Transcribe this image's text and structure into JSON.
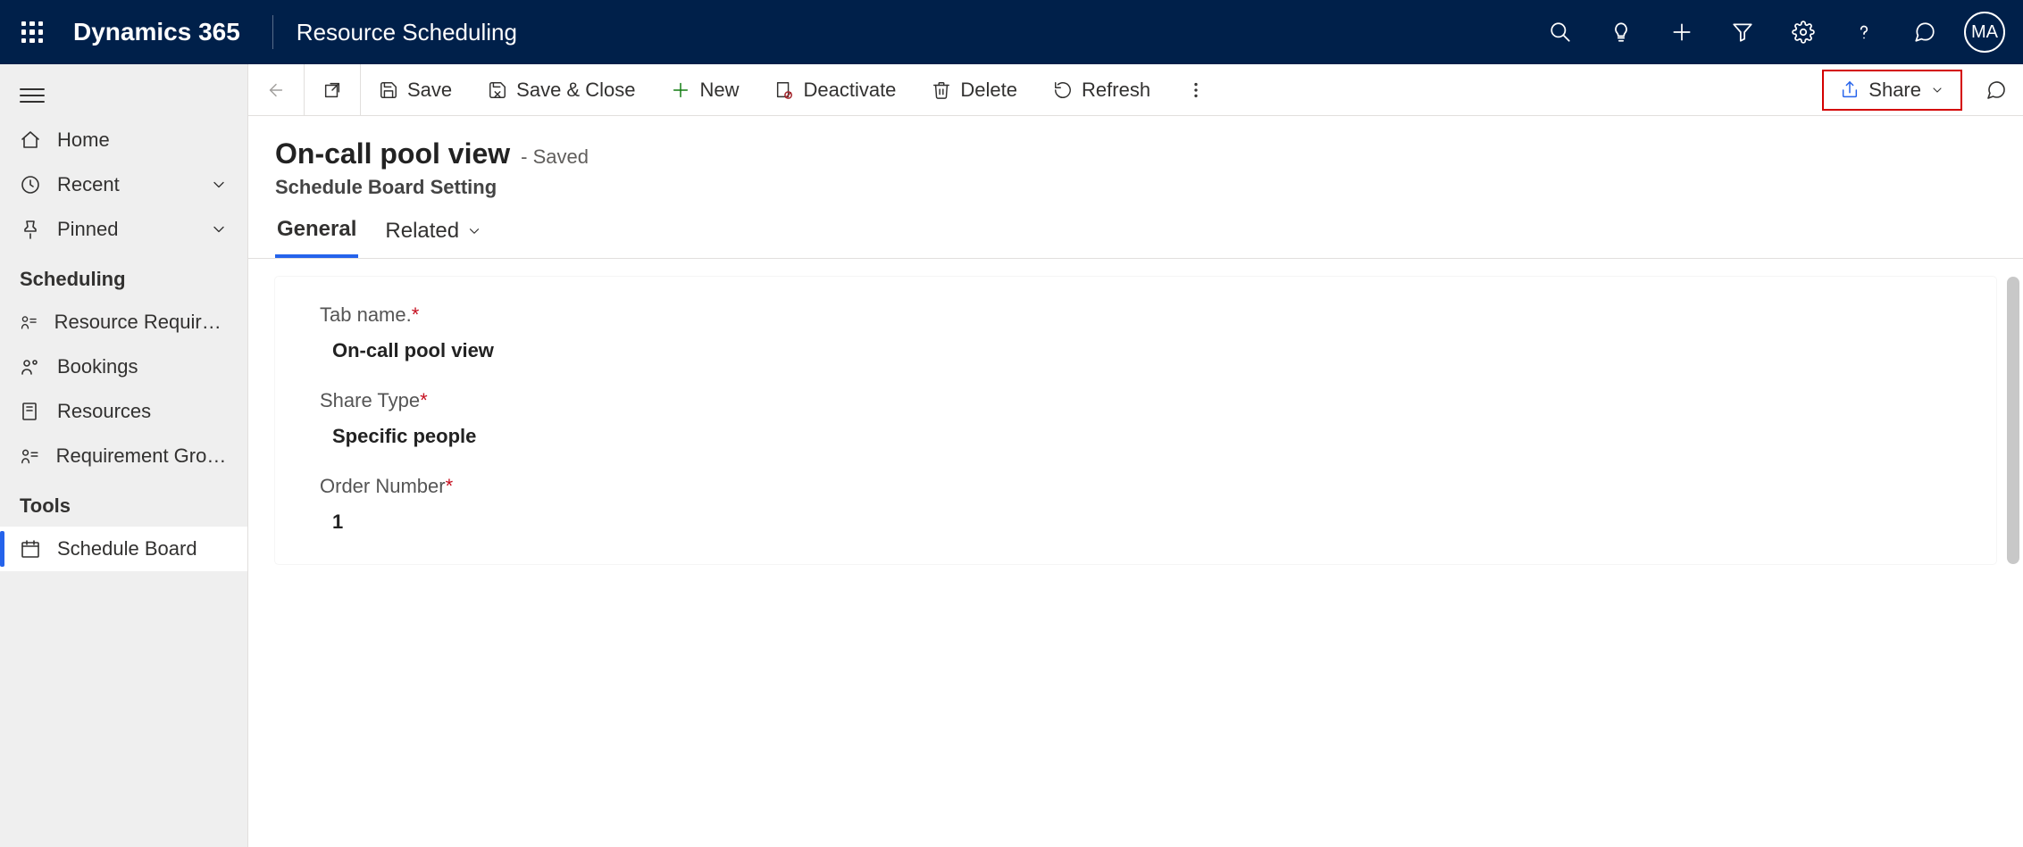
{
  "header": {
    "brand": "Dynamics 365",
    "app": "Resource Scheduling",
    "avatar": "MA"
  },
  "sidebar": {
    "home": "Home",
    "recent": "Recent",
    "pinned": "Pinned",
    "section1": "Scheduling",
    "items1": {
      "req": "Resource Requireme...",
      "bookings": "Bookings",
      "resources": "Resources",
      "reqgroups": "Requirement Groups"
    },
    "section2": "Tools",
    "items2": {
      "scheduleboard": "Schedule Board"
    }
  },
  "cmd": {
    "save": "Save",
    "saveclose": "Save & Close",
    "new": "New",
    "deactivate": "Deactivate",
    "delete": "Delete",
    "refresh": "Refresh",
    "share": "Share"
  },
  "page": {
    "title": "On-call pool view",
    "saved": "- Saved",
    "subtitle": "Schedule Board Setting"
  },
  "tabs": {
    "general": "General",
    "related": "Related"
  },
  "form": {
    "tabname": {
      "label": "Tab name.",
      "value": "On-call pool view"
    },
    "sharetype": {
      "label": "Share Type",
      "value": "Specific people"
    },
    "ordernumber": {
      "label": "Order Number",
      "value": "1"
    }
  }
}
